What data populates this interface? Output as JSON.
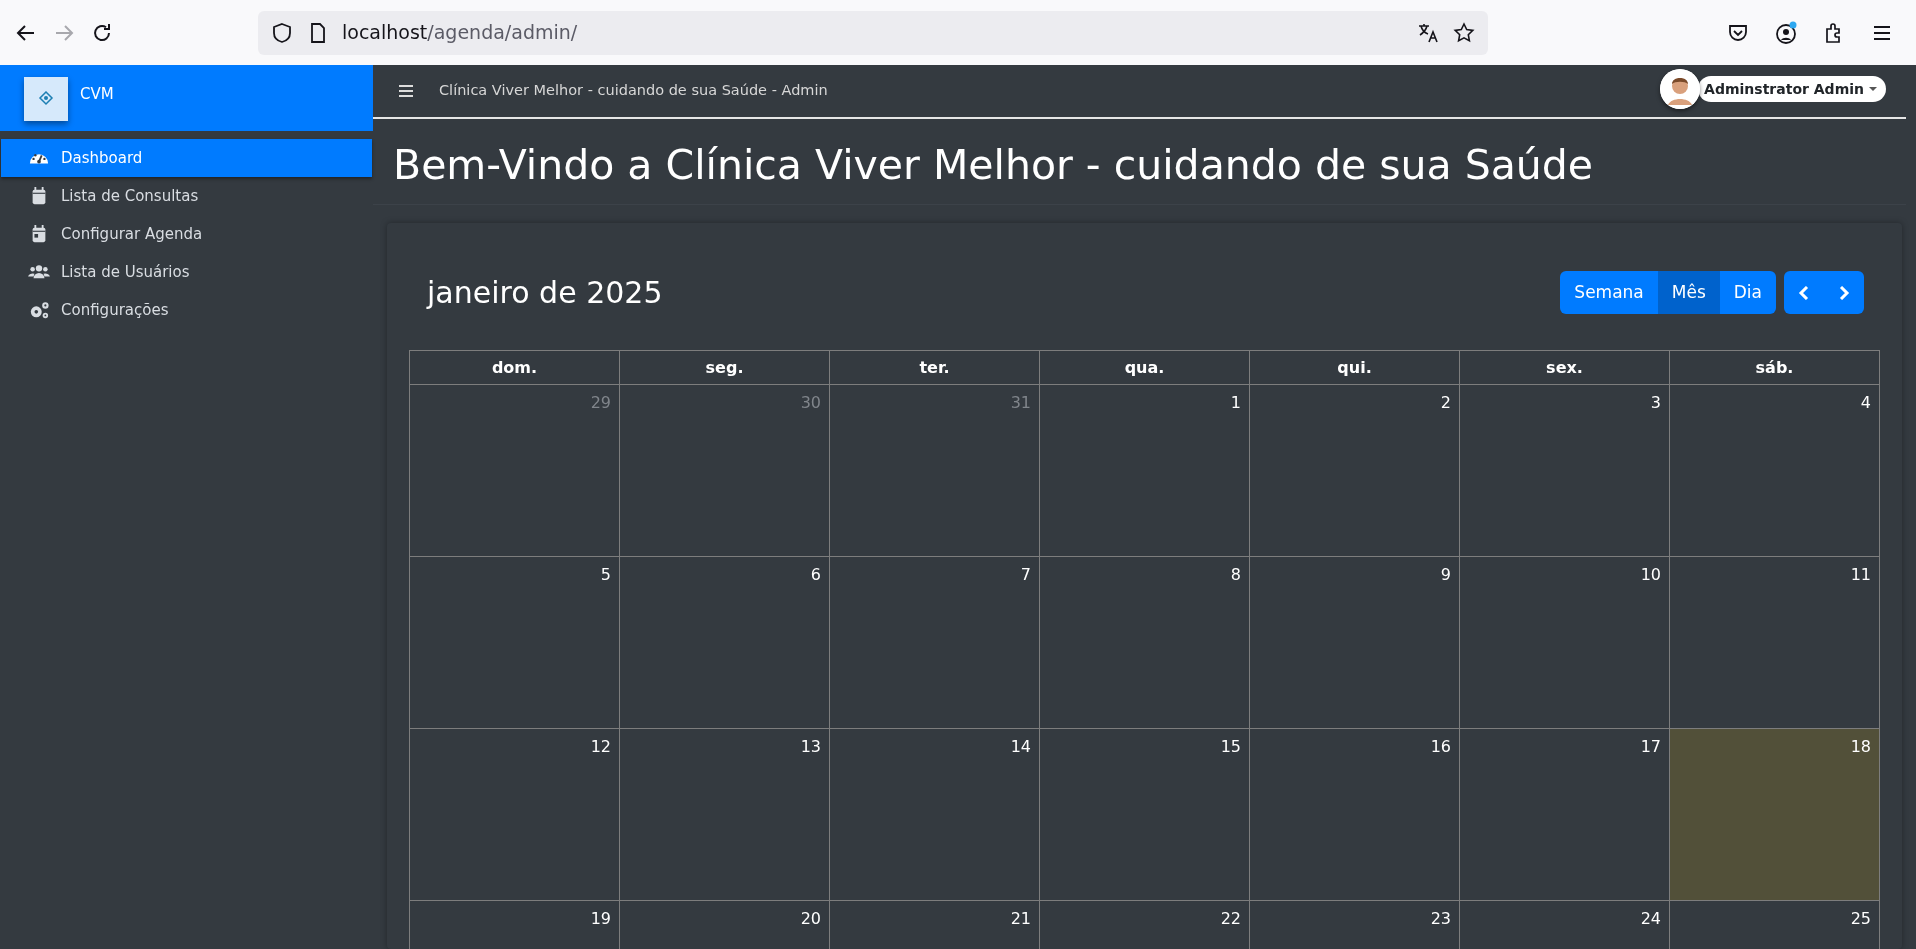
{
  "browser": {
    "url_host": "localhost",
    "url_path": "/agenda/admin/",
    "forward_disabled": true,
    "account_notice": true
  },
  "sidebar": {
    "brand": "CVM",
    "items": [
      {
        "label": "Dashboard",
        "selected": true
      },
      {
        "label": "Lista de Consultas",
        "selected": false
      },
      {
        "label": "Configurar Agenda",
        "selected": false
      },
      {
        "label": "Lista de Usuários",
        "selected": false
      },
      {
        "label": "Configurações",
        "selected": false
      }
    ]
  },
  "topbar": {
    "title": "Clínica Viver Melhor - cuidando de sua Saúde - Admin",
    "user": "Adminstrator Admin"
  },
  "heading": "Bem-Vindo a Clínica Viver Melhor - cuidando de sua Saúde",
  "calendar": {
    "title": "janeiro de 2025",
    "views": [
      {
        "label": "Semana",
        "selected": false
      },
      {
        "label": "Mês",
        "selected": true
      },
      {
        "label": "Dia",
        "selected": false
      }
    ],
    "weekdays": [
      "dom.",
      "seg.",
      "ter.",
      "qua.",
      "qui.",
      "sex.",
      "sáb."
    ],
    "weeks": [
      [
        {
          "day": "29",
          "other_month": true,
          "today": false
        },
        {
          "day": "30",
          "other_month": true,
          "today": false
        },
        {
          "day": "31",
          "other_month": true,
          "today": false
        },
        {
          "day": "1",
          "other_month": false,
          "today": false
        },
        {
          "day": "2",
          "other_month": false,
          "today": false
        },
        {
          "day": "3",
          "other_month": false,
          "today": false
        },
        {
          "day": "4",
          "other_month": false,
          "today": false
        }
      ],
      [
        {
          "day": "5",
          "other_month": false,
          "today": false
        },
        {
          "day": "6",
          "other_month": false,
          "today": false
        },
        {
          "day": "7",
          "other_month": false,
          "today": false
        },
        {
          "day": "8",
          "other_month": false,
          "today": false
        },
        {
          "day": "9",
          "other_month": false,
          "today": false
        },
        {
          "day": "10",
          "other_month": false,
          "today": false
        },
        {
          "day": "11",
          "other_month": false,
          "today": false
        }
      ],
      [
        {
          "day": "12",
          "other_month": false,
          "today": false
        },
        {
          "day": "13",
          "other_month": false,
          "today": false
        },
        {
          "day": "14",
          "other_month": false,
          "today": false
        },
        {
          "day": "15",
          "other_month": false,
          "today": false
        },
        {
          "day": "16",
          "other_month": false,
          "today": false
        },
        {
          "day": "17",
          "other_month": false,
          "today": false
        },
        {
          "day": "18",
          "other_month": false,
          "today": true
        }
      ],
      [
        {
          "day": "19",
          "other_month": false,
          "today": false
        },
        {
          "day": "20",
          "other_month": false,
          "today": false
        },
        {
          "day": "21",
          "other_month": false,
          "today": false
        },
        {
          "day": "22",
          "other_month": false,
          "today": false
        },
        {
          "day": "23",
          "other_month": false,
          "today": false
        },
        {
          "day": "24",
          "other_month": false,
          "today": false
        },
        {
          "day": "25",
          "other_month": false,
          "today": false
        }
      ]
    ]
  }
}
